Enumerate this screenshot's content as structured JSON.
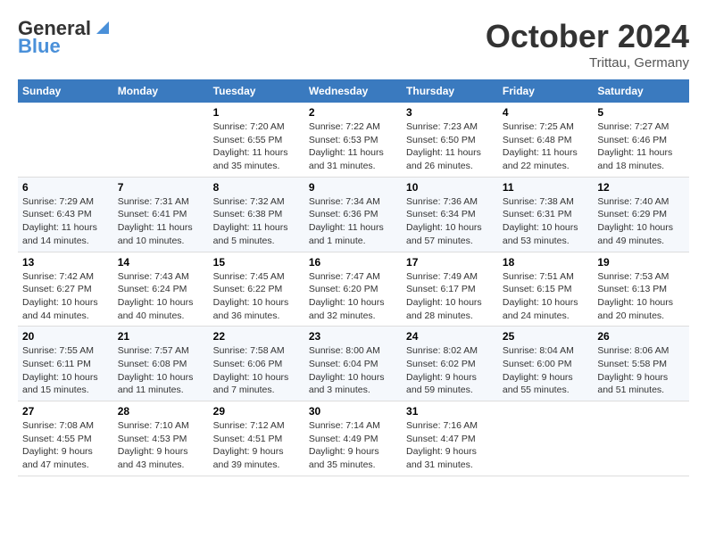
{
  "header": {
    "logo_line1": "General",
    "logo_line2": "Blue",
    "month_title": "October 2024",
    "subtitle": "Trittau, Germany"
  },
  "columns": [
    "Sunday",
    "Monday",
    "Tuesday",
    "Wednesday",
    "Thursday",
    "Friday",
    "Saturday"
  ],
  "weeks": [
    [
      {
        "day": "",
        "info": ""
      },
      {
        "day": "",
        "info": ""
      },
      {
        "day": "1",
        "info": "Sunrise: 7:20 AM\nSunset: 6:55 PM\nDaylight: 11 hours and 35 minutes."
      },
      {
        "day": "2",
        "info": "Sunrise: 7:22 AM\nSunset: 6:53 PM\nDaylight: 11 hours and 31 minutes."
      },
      {
        "day": "3",
        "info": "Sunrise: 7:23 AM\nSunset: 6:50 PM\nDaylight: 11 hours and 26 minutes."
      },
      {
        "day": "4",
        "info": "Sunrise: 7:25 AM\nSunset: 6:48 PM\nDaylight: 11 hours and 22 minutes."
      },
      {
        "day": "5",
        "info": "Sunrise: 7:27 AM\nSunset: 6:46 PM\nDaylight: 11 hours and 18 minutes."
      }
    ],
    [
      {
        "day": "6",
        "info": "Sunrise: 7:29 AM\nSunset: 6:43 PM\nDaylight: 11 hours and 14 minutes."
      },
      {
        "day": "7",
        "info": "Sunrise: 7:31 AM\nSunset: 6:41 PM\nDaylight: 11 hours and 10 minutes."
      },
      {
        "day": "8",
        "info": "Sunrise: 7:32 AM\nSunset: 6:38 PM\nDaylight: 11 hours and 5 minutes."
      },
      {
        "day": "9",
        "info": "Sunrise: 7:34 AM\nSunset: 6:36 PM\nDaylight: 11 hours and 1 minute."
      },
      {
        "day": "10",
        "info": "Sunrise: 7:36 AM\nSunset: 6:34 PM\nDaylight: 10 hours and 57 minutes."
      },
      {
        "day": "11",
        "info": "Sunrise: 7:38 AM\nSunset: 6:31 PM\nDaylight: 10 hours and 53 minutes."
      },
      {
        "day": "12",
        "info": "Sunrise: 7:40 AM\nSunset: 6:29 PM\nDaylight: 10 hours and 49 minutes."
      }
    ],
    [
      {
        "day": "13",
        "info": "Sunrise: 7:42 AM\nSunset: 6:27 PM\nDaylight: 10 hours and 44 minutes."
      },
      {
        "day": "14",
        "info": "Sunrise: 7:43 AM\nSunset: 6:24 PM\nDaylight: 10 hours and 40 minutes."
      },
      {
        "day": "15",
        "info": "Sunrise: 7:45 AM\nSunset: 6:22 PM\nDaylight: 10 hours and 36 minutes."
      },
      {
        "day": "16",
        "info": "Sunrise: 7:47 AM\nSunset: 6:20 PM\nDaylight: 10 hours and 32 minutes."
      },
      {
        "day": "17",
        "info": "Sunrise: 7:49 AM\nSunset: 6:17 PM\nDaylight: 10 hours and 28 minutes."
      },
      {
        "day": "18",
        "info": "Sunrise: 7:51 AM\nSunset: 6:15 PM\nDaylight: 10 hours and 24 minutes."
      },
      {
        "day": "19",
        "info": "Sunrise: 7:53 AM\nSunset: 6:13 PM\nDaylight: 10 hours and 20 minutes."
      }
    ],
    [
      {
        "day": "20",
        "info": "Sunrise: 7:55 AM\nSunset: 6:11 PM\nDaylight: 10 hours and 15 minutes."
      },
      {
        "day": "21",
        "info": "Sunrise: 7:57 AM\nSunset: 6:08 PM\nDaylight: 10 hours and 11 minutes."
      },
      {
        "day": "22",
        "info": "Sunrise: 7:58 AM\nSunset: 6:06 PM\nDaylight: 10 hours and 7 minutes."
      },
      {
        "day": "23",
        "info": "Sunrise: 8:00 AM\nSunset: 6:04 PM\nDaylight: 10 hours and 3 minutes."
      },
      {
        "day": "24",
        "info": "Sunrise: 8:02 AM\nSunset: 6:02 PM\nDaylight: 9 hours and 59 minutes."
      },
      {
        "day": "25",
        "info": "Sunrise: 8:04 AM\nSunset: 6:00 PM\nDaylight: 9 hours and 55 minutes."
      },
      {
        "day": "26",
        "info": "Sunrise: 8:06 AM\nSunset: 5:58 PM\nDaylight: 9 hours and 51 minutes."
      }
    ],
    [
      {
        "day": "27",
        "info": "Sunrise: 7:08 AM\nSunset: 4:55 PM\nDaylight: 9 hours and 47 minutes."
      },
      {
        "day": "28",
        "info": "Sunrise: 7:10 AM\nSunset: 4:53 PM\nDaylight: 9 hours and 43 minutes."
      },
      {
        "day": "29",
        "info": "Sunrise: 7:12 AM\nSunset: 4:51 PM\nDaylight: 9 hours and 39 minutes."
      },
      {
        "day": "30",
        "info": "Sunrise: 7:14 AM\nSunset: 4:49 PM\nDaylight: 9 hours and 35 minutes."
      },
      {
        "day": "31",
        "info": "Sunrise: 7:16 AM\nSunset: 4:47 PM\nDaylight: 9 hours and 31 minutes."
      },
      {
        "day": "",
        "info": ""
      },
      {
        "day": "",
        "info": ""
      }
    ]
  ]
}
